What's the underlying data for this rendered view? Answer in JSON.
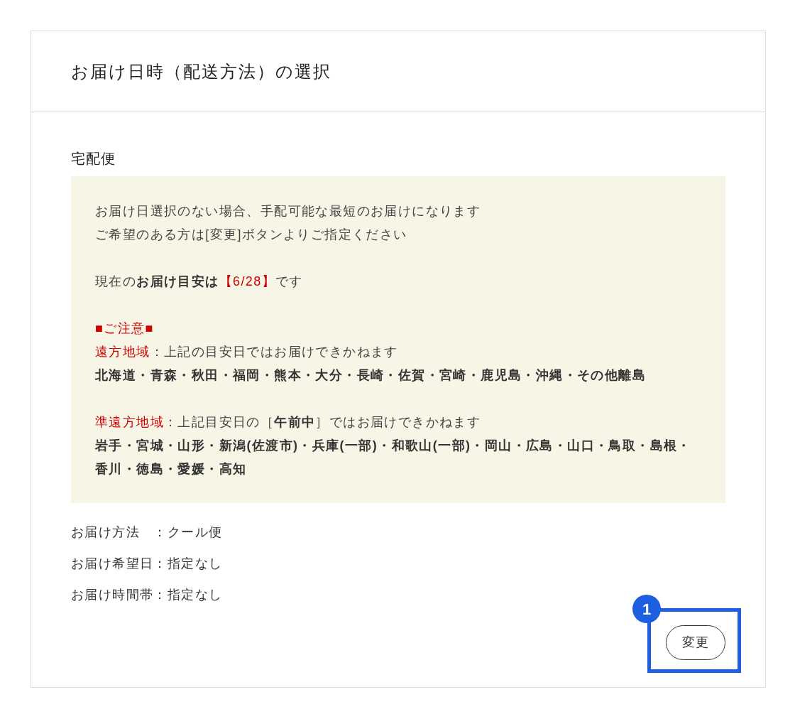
{
  "panel": {
    "title": "お届け日時（配送方法）の選択"
  },
  "section": {
    "heading": "宅配便"
  },
  "notice": {
    "paragraphs": [
      {
        "lines": [
          {
            "segments": [
              {
                "text": "お届け日選択のない場合、手配可能な最短のお届けになります",
                "kind": "plain"
              }
            ]
          },
          {
            "segments": [
              {
                "text": "ご希望のある方は[変更]ボタンよりご指定ください",
                "kind": "plain"
              }
            ]
          }
        ]
      },
      {
        "lines": [
          {
            "segments": [
              {
                "text": "現在の",
                "kind": "plain"
              },
              {
                "text": "お届け目安は",
                "kind": "strong"
              },
              {
                "text": "【6/28】",
                "kind": "alert"
              },
              {
                "text": "です",
                "kind": "plain"
              }
            ]
          }
        ]
      },
      {
        "lines": [
          {
            "segments": [
              {
                "text": "■ご注意■",
                "kind": "alert"
              }
            ]
          },
          {
            "segments": [
              {
                "text": "遠方地域",
                "kind": "alert"
              },
              {
                "text": "：上記の目安日ではお届けできかねます",
                "kind": "plain"
              }
            ]
          },
          {
            "segments": [
              {
                "text": "北海道・青森・秋田・福岡・熊本・大分・長崎・佐賀・宮崎・鹿児島・沖縄・その他離島",
                "kind": "strong"
              }
            ]
          }
        ]
      },
      {
        "lines": [
          {
            "segments": [
              {
                "text": "準遠方地域",
                "kind": "alert"
              },
              {
                "text": "：上記目安日の［",
                "kind": "plain"
              },
              {
                "text": "午前中",
                "kind": "strong"
              },
              {
                "text": "］ではお届けできかねます",
                "kind": "plain"
              }
            ]
          },
          {
            "segments": [
              {
                "text": "岩手・宮城・山形・新潟(佐渡市)・兵庫(一部)・和歌山(一部)・岡山・広島・山口・鳥取・島根・香川・徳島・愛媛・高知",
                "kind": "strong"
              }
            ]
          }
        ]
      }
    ]
  },
  "details": [
    {
      "label": "お届け方法",
      "separator": "：",
      "value": "クール便"
    },
    {
      "label": "お届け希望日",
      "separator": "：",
      "value": "指定なし"
    },
    {
      "label": "お届け時間帯",
      "separator": "：",
      "value": "指定なし"
    }
  ],
  "change_button": {
    "label": "変更"
  },
  "annotation": {
    "label": "1"
  }
}
